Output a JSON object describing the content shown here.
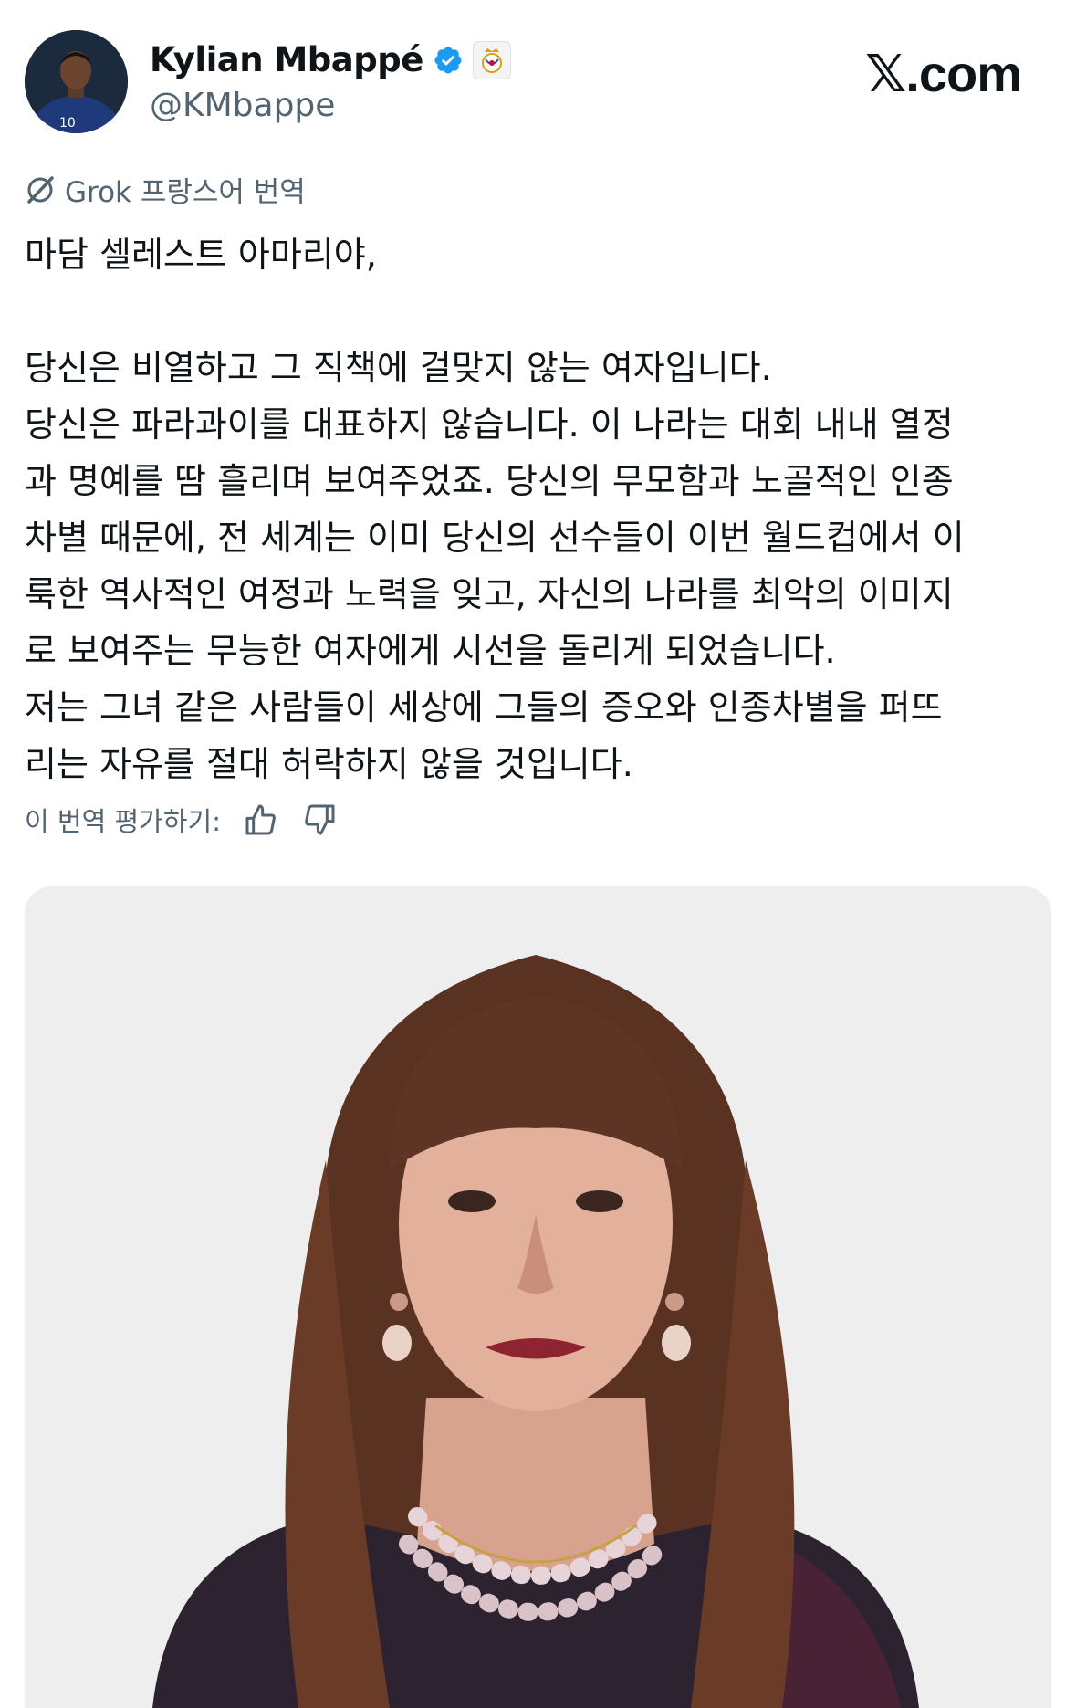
{
  "author": {
    "display_name": "Kylian Mbappé",
    "handle": "@KMbappe",
    "verified": true,
    "avatar_jersey_number": "10",
    "colors": {
      "verified_badge": "#1d9bf0",
      "jersey": "#1f3a7a"
    }
  },
  "brand": {
    "logo_text": "𝕏.com"
  },
  "translation": {
    "label": "Grok 프랑스어 번역"
  },
  "tweet": {
    "lines": [
      "마담 셀레스트 아마리야,",
      "",
      "당신은 비열하고 그 직책에 걸맞지 않는 여자입니다.",
      "당신은 파라과이를 대표하지 않습니다. 이 나라는 대회 내내 열정",
      "과 명예를 땀 흘리며 보여주었죠. 당신의 무모함과 노골적인 인종",
      "차별 때문에, 전 세계는 이미 당신의 선수들이 이번 월드컵에서 이",
      "룩한 역사적인 여정과 노력을 잊고, 자신의 나라를 최악의 이미지",
      "로 보여주는 무능한 여자에게 시선을 돌리게 되었습니다.",
      "저는 그녀 같은 사람들이 세상에 그들의 증오와 인종차별을 퍼뜨",
      "리는 자유를 절대 허락하지 않을 것입니다."
    ]
  },
  "rating": {
    "label": "이 번역 평가하기:",
    "thumbs_up_icon": "thumbs-up-icon",
    "thumbs_down_icon": "thumbs-down-icon"
  },
  "media": {
    "type": "photo",
    "subject": "portrait",
    "background": "#eeeeef"
  }
}
